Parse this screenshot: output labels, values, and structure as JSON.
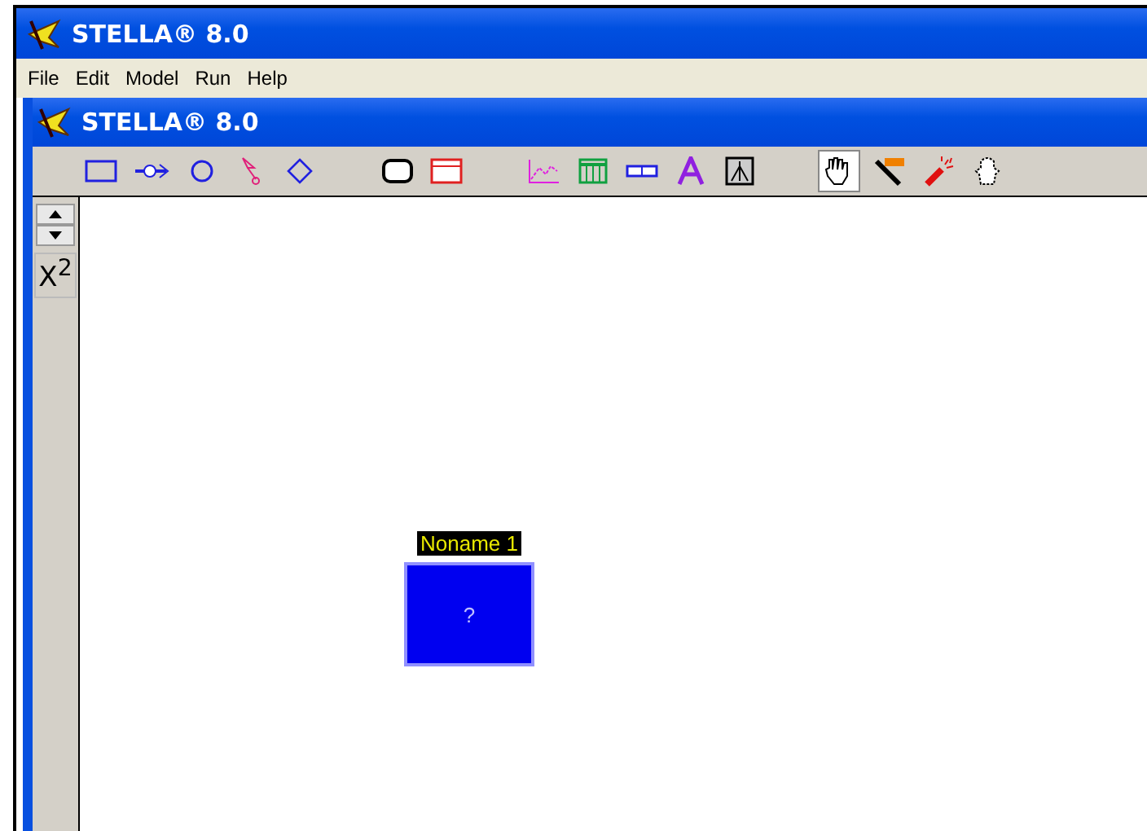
{
  "window": {
    "title": "STELLA® 8.0"
  },
  "menu": [
    "File",
    "Edit",
    "Model",
    "Run",
    "Help"
  ],
  "document": {
    "title": "STELLA® 8.0"
  },
  "toolbar": {
    "groups": [
      {
        "tools": [
          {
            "kind": "stock",
            "selected": false
          },
          {
            "kind": "flow",
            "selected": false
          },
          {
            "kind": "converter",
            "selected": false
          },
          {
            "kind": "connector",
            "selected": false
          },
          {
            "kind": "decision",
            "selected": false
          }
        ]
      },
      {
        "tools": [
          {
            "kind": "button",
            "selected": false
          },
          {
            "kind": "panel",
            "selected": false
          }
        ]
      },
      {
        "tools": [
          {
            "kind": "graph",
            "selected": false
          },
          {
            "kind": "table",
            "selected": false
          },
          {
            "kind": "slider",
            "selected": false
          },
          {
            "kind": "text",
            "selected": false
          },
          {
            "kind": "picture",
            "selected": false
          }
        ]
      },
      {
        "tools": [
          {
            "kind": "hand",
            "selected": true
          },
          {
            "kind": "brush",
            "selected": false
          },
          {
            "kind": "dynamite",
            "selected": false
          },
          {
            "kind": "ghost",
            "selected": false
          }
        ]
      }
    ]
  },
  "side": {
    "equation_button": "X$^{2}$"
  },
  "canvas": {
    "module": {
      "name": "Noname 1",
      "mark": "?"
    }
  }
}
